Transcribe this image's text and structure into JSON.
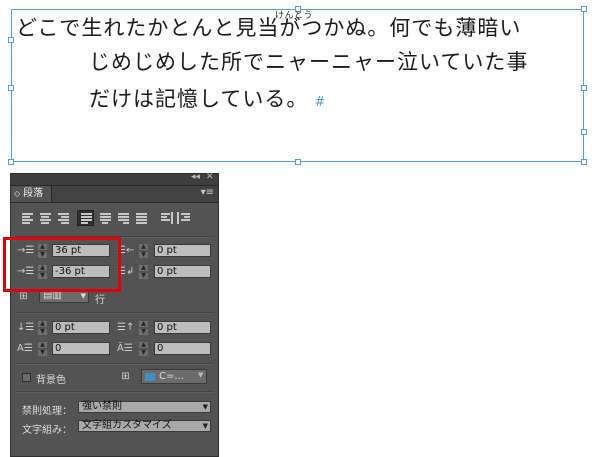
{
  "text_frame": {
    "ruby": "けんとう",
    "lines": [
      "どこで生れたかとんと見当がつかぬ。何でも薄暗い",
      "じめじめした所でニャーニャー泣いていた事",
      "だけは記憶している。"
    ],
    "paragraph_mark": "#"
  },
  "panel": {
    "collapse_glyph": "◂◂",
    "close_glyph": "✕",
    "tab_label": "段落",
    "menu_glyph": "▾≡",
    "alignment_buttons": [
      "left",
      "center",
      "right",
      "justify-left",
      "justify-center",
      "justify-right",
      "justify-all",
      "towards-spine",
      "away-from-spine"
    ],
    "selected_alignment": "justify-left",
    "left_indent": "36 pt",
    "first_line_indent": "-36 pt",
    "right_indent": "0 pt",
    "last_line_right_indent": "0 pt",
    "grid_unit_label": "行",
    "space_before": "0 pt",
    "space_after": "0 pt",
    "drop_cap_lines": "0",
    "drop_cap_chars": "0",
    "shading_label": "背景色",
    "shading_color_label": "C=...",
    "shading_color": "#3f8fc6",
    "kinsoku_label": "禁則処理：",
    "kinsoku_value": "強い禁則",
    "mojikumi_label": "文字組み：",
    "mojikumi_value": "文字組カスタマイズ"
  },
  "colors": {
    "frame": "#5b9bd5",
    "highlight": "#e0000b",
    "panel_bg": "#535353"
  }
}
